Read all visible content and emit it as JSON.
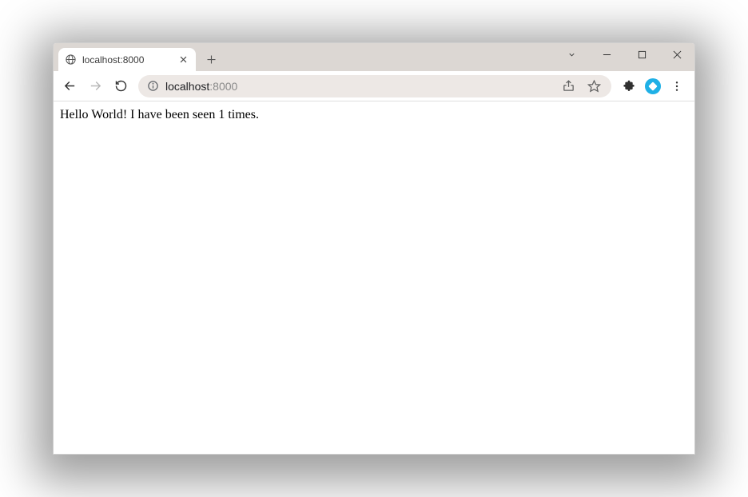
{
  "window": {
    "controls": {
      "chevron": "v",
      "minimize": "–",
      "maximize": "□",
      "close": "×"
    }
  },
  "tab": {
    "title": "localhost:8000"
  },
  "address": {
    "host": "localhost",
    "port": ":8000"
  },
  "page": {
    "body": "Hello World! I have been seen 1 times."
  }
}
